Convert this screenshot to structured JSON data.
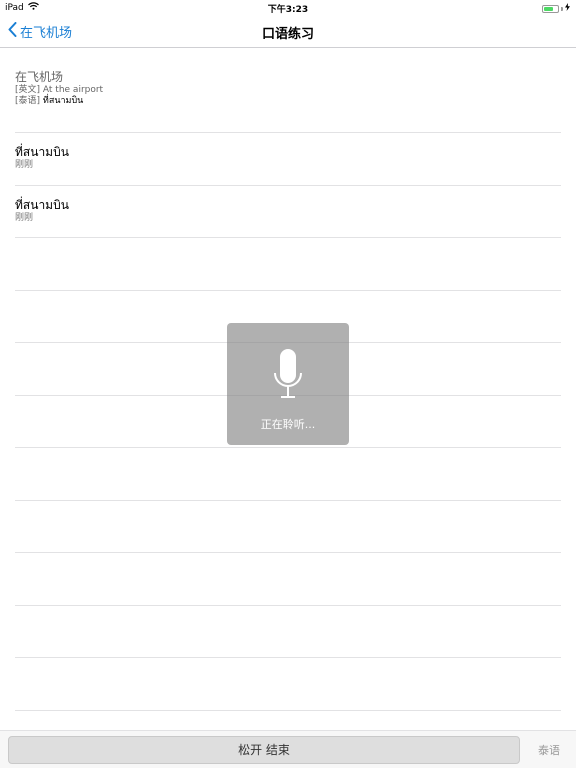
{
  "status_bar": {
    "device": "iPad",
    "time": "下午3:23",
    "battery_level": 0.7,
    "battery_color": "#4cd964"
  },
  "nav": {
    "back_label": "在飞机场",
    "title": "口语练习",
    "accent_color": "#1a7fd4"
  },
  "header": {
    "title": "在飞机场",
    "english_prefix": "[英文]",
    "english_text": "At the airport",
    "thai_prefix": "[泰语]",
    "thai_text": "ที่สนามบิน"
  },
  "records": [
    {
      "text": "ที่สนามบิน",
      "time": "刚刚"
    },
    {
      "text": "ที่สนามบิน",
      "time": "刚刚"
    }
  ],
  "overlay": {
    "icon": "microphone-icon",
    "text": "正在聆听..."
  },
  "toolbar": {
    "hold_label": "松开 结束",
    "language_label": "泰语"
  }
}
